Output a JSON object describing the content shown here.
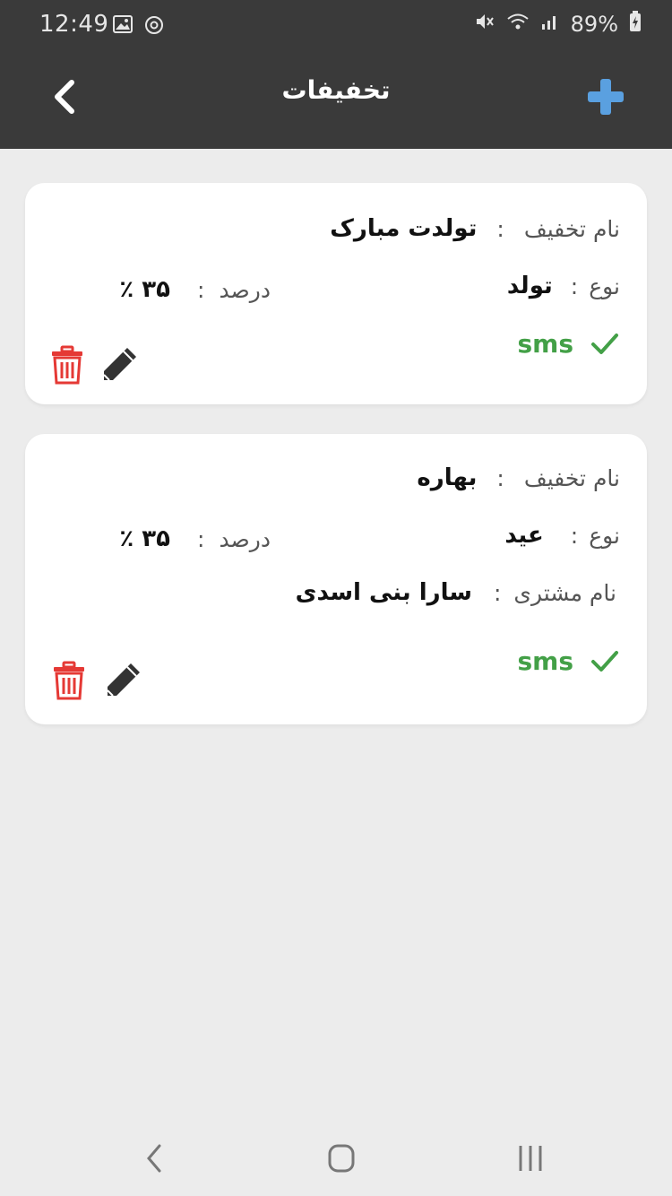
{
  "status_bar": {
    "time": "12:49",
    "battery": "89%",
    "icons_left": [
      "image-icon",
      "sync-icon"
    ],
    "icons_right": [
      "mute-icon",
      "wifi-icon",
      "signal-icon",
      "battery-icon"
    ]
  },
  "app_bar": {
    "title": "تخفیفات",
    "back_icon": "chevron-left-icon",
    "add_icon": "plus-icon",
    "add_color": "#5aa0e0"
  },
  "labels": {
    "discount_name": "نام تخفیف",
    "type": "نوع",
    "percent": "درصد",
    "customer_name": "نام مشتری",
    "colon": ":",
    "sms": "sms"
  },
  "discounts": [
    {
      "name": "تولدت مبارک",
      "type": "تولد",
      "percent": "۳۵ ٪",
      "sms": "sms"
    },
    {
      "name": "بهاره",
      "type": "عید",
      "percent": "۳۵ ٪",
      "customer": "سارا بنی اسدی",
      "sms": "sms"
    }
  ],
  "colors": {
    "bar": "#3a3a3a",
    "background": "#ececec",
    "sms_green": "#43a047",
    "delete_red": "#e53935",
    "edit_dark": "#333333"
  },
  "nav_bar": [
    "back-nav-icon",
    "home-nav-icon",
    "recents-nav-icon"
  ]
}
